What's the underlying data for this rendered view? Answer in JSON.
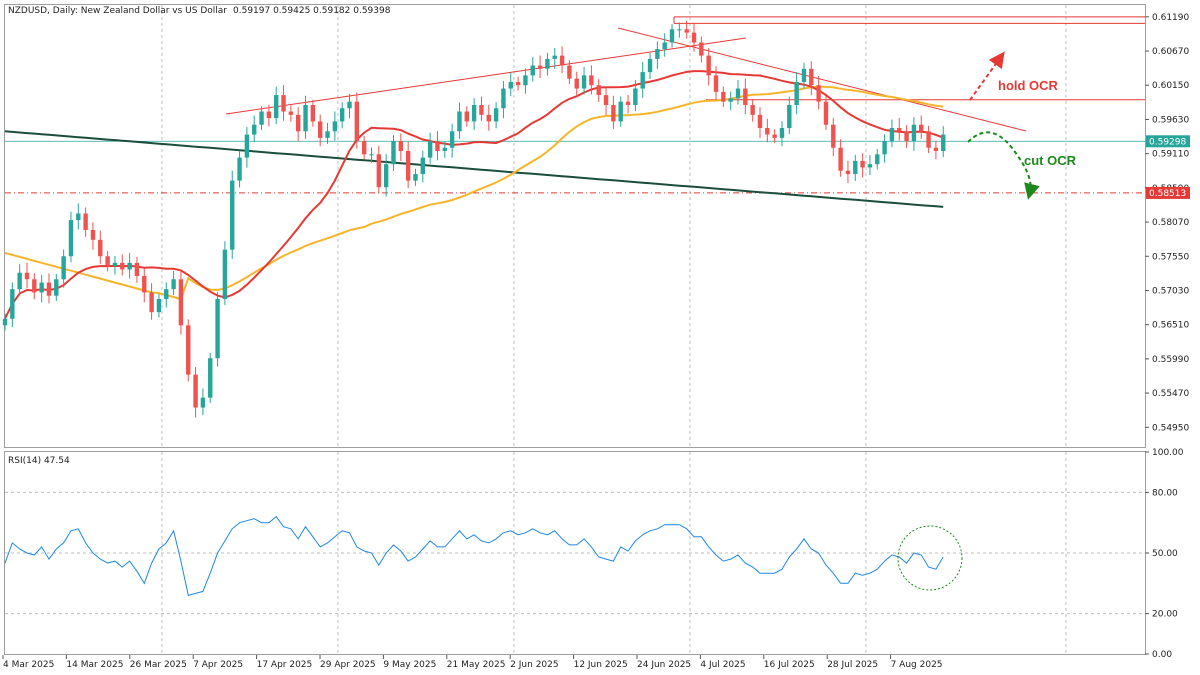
{
  "header": {
    "title": "NZDUSD, Daily:  New Zealand Dollar vs US Dollar",
    "ohlc": "0.59197 0.59425 0.59182 0.59398"
  },
  "rsi_header": "RSI(14) 47.54",
  "colors": {
    "bull": "#26a69a",
    "bear": "#ef5350",
    "ma_fast": "#e53935",
    "ma_mid": "#f5b52a",
    "ma_slow": "#1b4d3e",
    "rsi": "#1e88e5",
    "grid": "#bdbdbd",
    "annot_red": "#e53935",
    "annot_green": "#1b8a1b"
  },
  "chart_data": [
    {
      "type": "candlestick",
      "title": "NZDUSD, Daily",
      "x_tick_labels": [
        "4 Mar 2025",
        "14 Mar 2025",
        "26 Mar 2025",
        "7 Apr 2025",
        "17 Apr 2025",
        "29 Apr 2025",
        "9 May 2025",
        "21 May 2025",
        "2 Jun 2025",
        "12 Jun 2025",
        "24 Jun 2025",
        "4 Jul 2025",
        "16 Jul 2025",
        "28 Jul 2025",
        "7 Aug 2025"
      ],
      "y_ticks": [
        "0.61190",
        "0.60670",
        "0.60150",
        "0.59630",
        "0.59110",
        "0.58590",
        "0.58070",
        "0.57550",
        "0.57030",
        "0.56510",
        "0.55990",
        "0.55470",
        "0.54950"
      ],
      "ylim": [
        0.5465,
        0.6137
      ],
      "price_badge": "0.59298",
      "support_badge": "0.58513",
      "current_price": 0.59298,
      "support_level": 0.58513,
      "resistance_levels": [
        0.6119,
        0.6109,
        0.5993
      ],
      "closes": [
        0.566,
        0.5705,
        0.573,
        0.572,
        0.57,
        0.5715,
        0.5695,
        0.572,
        0.5755,
        0.581,
        0.582,
        0.5795,
        0.578,
        0.5755,
        0.574,
        0.5745,
        0.5735,
        0.5745,
        0.5725,
        0.57,
        0.567,
        0.569,
        0.5705,
        0.572,
        0.565,
        0.5575,
        0.5525,
        0.554,
        0.56,
        0.569,
        0.5765,
        0.587,
        0.5905,
        0.594,
        0.5955,
        0.5975,
        0.5965,
        0.6,
        0.5975,
        0.597,
        0.5945,
        0.5985,
        0.596,
        0.5935,
        0.5945,
        0.596,
        0.598,
        0.599,
        0.593,
        0.591,
        0.591,
        0.586,
        0.5895,
        0.593,
        0.5915,
        0.587,
        0.588,
        0.5905,
        0.593,
        0.5915,
        0.592,
        0.5945,
        0.5975,
        0.596,
        0.5985,
        0.597,
        0.596,
        0.598,
        0.601,
        0.602,
        0.6015,
        0.603,
        0.6045,
        0.604,
        0.6055,
        0.606,
        0.6045,
        0.6025,
        0.601,
        0.603,
        0.6015,
        0.6,
        0.5985,
        0.596,
        0.599,
        0.5985,
        0.601,
        0.6035,
        0.6055,
        0.607,
        0.608,
        0.61,
        0.61,
        0.6095,
        0.608,
        0.606,
        0.603,
        0.6005,
        0.599,
        0.5995,
        0.601,
        0.5985,
        0.597,
        0.595,
        0.594,
        0.5935,
        0.595,
        0.5985,
        0.602,
        0.604,
        0.6015,
        0.599,
        0.5955,
        0.592,
        0.5885,
        0.588,
        0.59,
        0.589,
        0.5895,
        0.591,
        0.593,
        0.595,
        0.5945,
        0.593,
        0.5955,
        0.5945,
        0.592,
        0.5915,
        0.594
      ]
    },
    {
      "type": "line",
      "title": "RSI(14) 47.54",
      "y_ticks": [
        "100.00",
        "80.00",
        "50.00",
        "20.00",
        "0.00"
      ],
      "ylim": [
        0,
        100
      ],
      "last_value": 47.54,
      "series": [
        {
          "values": [
            45,
            55,
            52,
            50,
            49,
            53,
            47,
            52,
            55,
            61,
            62,
            55,
            50,
            47,
            45,
            46,
            43,
            46,
            41,
            35,
            45,
            52,
            55,
            61,
            46,
            29,
            30,
            31,
            40,
            50,
            56,
            62,
            65,
            66,
            67,
            65,
            65,
            68,
            63,
            62,
            57,
            63,
            58,
            53,
            55,
            58,
            61,
            60,
            53,
            51,
            50,
            44,
            50,
            54,
            51,
            46,
            48,
            52,
            56,
            53,
            53,
            57,
            61,
            57,
            59,
            56,
            55,
            57,
            60,
            61,
            59,
            60,
            62,
            60,
            59,
            61,
            57,
            54,
            54,
            57,
            53,
            48,
            47,
            46,
            53,
            51,
            56,
            59,
            61,
            62,
            64,
            64,
            64,
            62,
            58,
            58,
            53,
            49,
            46,
            47,
            49,
            45,
            43,
            40,
            40,
            40,
            42,
            48,
            52,
            57,
            52,
            50,
            44,
            40,
            35,
            35,
            40,
            39,
            40,
            42,
            46,
            49,
            48,
            45,
            50,
            49,
            43,
            42,
            48
          ]
        }
      ]
    }
  ],
  "annotations": {
    "hold": "hold OCR",
    "cut": "cut OCR"
  }
}
